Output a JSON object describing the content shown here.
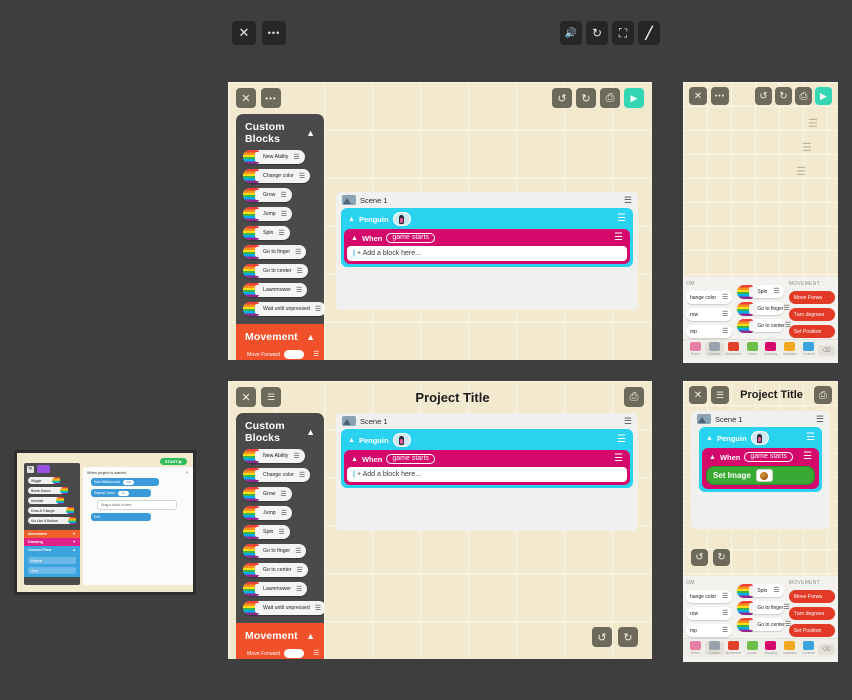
{
  "app": {
    "background_color": "#3e3e3e",
    "paper_color": "#f3e9cf",
    "accent_cyan": "#29d2ef",
    "accent_magenta": "#d4096b",
    "accent_orange": "#f0502a",
    "accent_green": "#3aa934",
    "accent_play": "#34d6b4"
  },
  "global_toolbar": {
    "left": [
      {
        "name": "close-icon",
        "glyph": "✕"
      },
      {
        "name": "more-options-icon",
        "glyph": "•••"
      }
    ],
    "right": [
      {
        "name": "volume-icon",
        "glyph": "🔊"
      },
      {
        "name": "refresh-icon",
        "glyph": "↻"
      },
      {
        "name": "fullscreen-icon",
        "glyph": "⛶"
      },
      {
        "name": "pen-icon",
        "glyph": "╱"
      }
    ]
  },
  "custom_blocks_drawer": {
    "title": "Custom Blocks",
    "collapse_icon": "chevron-up-icon",
    "blocks": [
      {
        "label": "New Ability"
      },
      {
        "label": "Change color"
      },
      {
        "label": "Grow"
      },
      {
        "label": "Jump"
      },
      {
        "label": "Spin"
      },
      {
        "label": "Go to finger"
      },
      {
        "label": "Go to center"
      },
      {
        "label": "Lawnmower"
      },
      {
        "label": "Wait until unpressed"
      }
    ]
  },
  "movement_drawer": {
    "title": "Movement",
    "collapse_icon": "chevron-up-icon",
    "blocks": [
      {
        "label": "Move Forward"
      }
    ]
  },
  "scene": {
    "name": "Scene 1",
    "menu_icon": "hamburger-icon",
    "sprite": {
      "name": "Penguin",
      "avatar": "penguin-avatar",
      "menu_icon": "hamburger-icon",
      "rule": {
        "keyword": "When",
        "trigger": "game starts",
        "menu_icon": "hamburger-icon",
        "empty_slot": "+ Add a block here...",
        "filled_block": {
          "label": "Set Image",
          "thumb": "basketball-image"
        }
      }
    }
  },
  "panel1": {
    "toolbar_left": [
      {
        "name": "close-icon",
        "glyph": "✕"
      },
      {
        "name": "more-options-icon",
        "glyph": "•••"
      }
    ],
    "toolbar_right": [
      {
        "name": "undo-icon",
        "glyph": "↺"
      },
      {
        "name": "redo-icon",
        "glyph": "↻"
      },
      {
        "name": "print-icon",
        "glyph": "⎙"
      },
      {
        "name": "play-icon",
        "glyph": "▶"
      }
    ]
  },
  "panel2": {
    "title": "Project Title",
    "toolbar_left": [
      {
        "name": "close-icon",
        "glyph": "✕"
      },
      {
        "name": "layers-icon",
        "glyph": "☰"
      }
    ],
    "toolbar_right": [
      {
        "name": "print-icon",
        "glyph": "⎙"
      }
    ],
    "footer": [
      {
        "name": "undo-icon",
        "glyph": "↺"
      },
      {
        "name": "redo-icon",
        "glyph": "↻"
      }
    ]
  },
  "panel3": {
    "toolbar_left": [
      {
        "name": "close-icon",
        "glyph": "✕"
      },
      {
        "name": "more-options-icon",
        "glyph": "•••"
      }
    ],
    "toolbar_right": [
      {
        "name": "undo-icon",
        "glyph": "↺"
      },
      {
        "name": "redo-icon",
        "glyph": "↻"
      },
      {
        "name": "print-icon",
        "glyph": "⎙"
      },
      {
        "name": "play-icon",
        "glyph": "▶"
      }
    ],
    "floating_menus": [
      "hamburger-icon",
      "hamburger-icon",
      "hamburger-icon"
    ]
  },
  "panel4": {
    "title": "Project Title",
    "toolbar_left": [
      {
        "name": "close-icon",
        "glyph": "✕"
      },
      {
        "name": "layers-icon",
        "glyph": "☰"
      }
    ],
    "toolbar_right": [
      {
        "name": "print-icon",
        "glyph": "⎙"
      }
    ],
    "footer": [
      {
        "name": "undo-icon",
        "glyph": "↺"
      },
      {
        "name": "redo-icon",
        "glyph": "↻"
      }
    ]
  },
  "block_palette": {
    "captions": [
      "OM",
      "",
      "MOVEMENT"
    ],
    "col1": [
      {
        "label": "hange color"
      },
      {
        "label": "row"
      },
      {
        "label": "mp"
      }
    ],
    "col2": [
      {
        "label": "Spin"
      },
      {
        "label": "Go to finger"
      },
      {
        "label": "Go to center"
      }
    ],
    "col3": [
      {
        "label": "Move Forwa"
      },
      {
        "label": "Turn degrees"
      },
      {
        "label": "Set Position"
      }
    ],
    "tabs": [
      {
        "label": "Rules",
        "icon": "rules-icon",
        "color": "#e87fa8",
        "selected": false
      },
      {
        "label": "Custom",
        "icon": "custom-icon",
        "color": "#9aa3ab",
        "selected": true
      },
      {
        "label": "Movement",
        "icon": "movement-icon",
        "color": "#e2402a",
        "selected": false
      },
      {
        "label": "Looks",
        "icon": "looks-icon",
        "color": "#6cc04a",
        "selected": false
      },
      {
        "label": "Drawing",
        "icon": "drawing-icon",
        "color": "#d4096b",
        "selected": false
      },
      {
        "label": "Variables",
        "icon": "variables-icon",
        "color": "#f2a81d",
        "selected": false
      },
      {
        "label": "Controls",
        "icon": "controls-icon",
        "color": "#3ba3dd",
        "selected": false
      }
    ],
    "delete_key": "⌫"
  },
  "thumbnail": {
    "close_icon": "close-icon",
    "start_button": "START ▶",
    "rule_title": "When project is started",
    "collapse_icon": "chevron-down-icon",
    "abilities": [
      {
        "label": "Wiggle"
      },
      {
        "label": "Break Dance"
      },
      {
        "label": "Animate"
      },
      {
        "label": "Draw A Triangle"
      },
      {
        "label": "Act Like A Balloon"
      }
    ],
    "categories": [
      {
        "label": "Movement",
        "color": "#f0602a"
      },
      {
        "label": "Drawing",
        "color": "#e0218a"
      },
      {
        "label": "Control Flow",
        "color": "#3ba3dd"
      }
    ],
    "control_blocks": [
      {
        "label": "Repeat"
      },
      {
        "label": "Wait"
      }
    ],
    "script": [
      {
        "label": "Wait Milliseconds",
        "value": "500"
      },
      {
        "label": "Repeat Times",
        "value": "10"
      },
      {
        "label": "Drag a block in here"
      },
      {
        "label": "End"
      }
    ]
  }
}
